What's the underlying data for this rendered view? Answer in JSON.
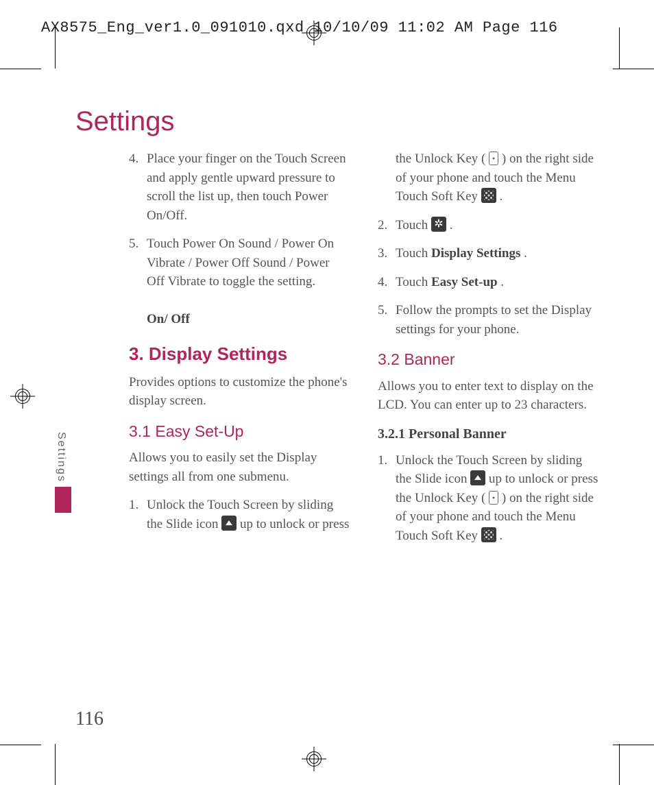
{
  "header": "AX8575_Eng_ver1.0_091010.qxd  10/10/09  11:02 AM  Page 116",
  "page_title": "Settings",
  "side_tab": "Settings",
  "page_number": "116",
  "col": {
    "step4_num": "4.",
    "step4": "Place your finger on the Touch Screen and apply gentle upward pressure to scroll the list up, then touch Power On/Off.",
    "step5_num": "5.",
    "step5": "Touch Power On Sound / Power On Vibrate / Power Off Sound / Power Off Vibrate to toggle the setting.",
    "onoff": "On/ Off",
    "h_display": "3. Display Settings",
    "display_intro": "Provides options to customize the phone's display screen.",
    "h_easy": "3.1 Easy Set-Up",
    "easy_intro": "Allows you to easily set the Display settings all from one submenu.",
    "easy1_num": "1.",
    "easy1a": "Unlock the Touch Screen by sliding the Slide icon ",
    "easy1b": " up to unlock or press the Unlock Key ( ",
    "easy1c": " ) on the right side of your phone and touch the Menu Touch Soft Key ",
    "period": " .",
    "e2_num": "2.",
    "e2a": "Touch ",
    "e3_num": "3.",
    "e3a": "Touch ",
    "e3b": "Display Settings",
    "e4_num": "4.",
    "e4a": "Touch ",
    "e4b": "Easy Set-up",
    "e5_num": "5.",
    "e5": "Follow the prompts to set the Display settings for your phone.",
    "h_banner": "3.2 Banner",
    "banner_intro": "Allows you to enter text to display on the LCD. You can enter up to 23 characters.",
    "h_personal": "3.2.1 Personal Banner",
    "pb1_num": "1.",
    "pb1a": "Unlock the Touch Screen by sliding the Slide icon ",
    "pb1b": " up to unlock or press the Unlock Key ( ",
    "pb1c": " ) on the right side of your phone and touch the Menu Touch Soft Key "
  }
}
